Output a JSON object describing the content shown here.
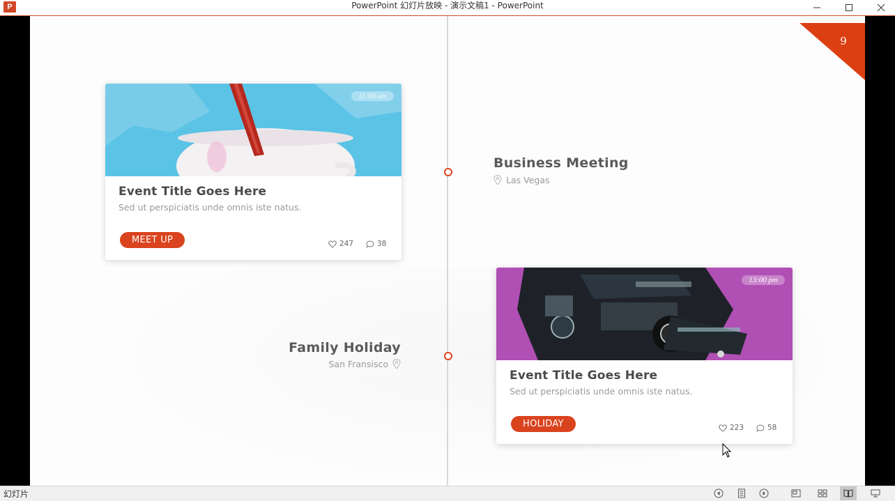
{
  "window": {
    "title": "PowerPoint 幻灯片放映  -  演示文稿1 - PowerPoint",
    "app_icon_letter": "P"
  },
  "slide": {
    "number": "9",
    "accent_color": "#d9431e",
    "cards": [
      {
        "time": "11:00 am",
        "title": "Event Title Goes Here",
        "subtitle": "Sed ut perspiciatis unde omnis  iste natus.",
        "button": "MEET UP",
        "likes": "247",
        "comments": "38",
        "image_bg": "#5bc3e6"
      },
      {
        "time": "13:00 pm",
        "title": "Event Title Goes Here",
        "subtitle": "Sed ut perspiciatis unde omnis  iste natus.",
        "button": "HOLIDAY",
        "likes": "223",
        "comments": "58",
        "image_bg": "#b04fb4"
      }
    ],
    "events": [
      {
        "title": "Business  Meeting",
        "location": "Las Vegas"
      },
      {
        "title": "Family Holiday",
        "location": "San Fransisco"
      }
    ]
  },
  "statusbar": {
    "label": "幻灯片",
    "icons": [
      "previous-icon",
      "menu-icon",
      "next-icon",
      "normal-view-icon",
      "slide-sorter-icon",
      "reading-view-icon",
      "slideshow-icon"
    ]
  }
}
